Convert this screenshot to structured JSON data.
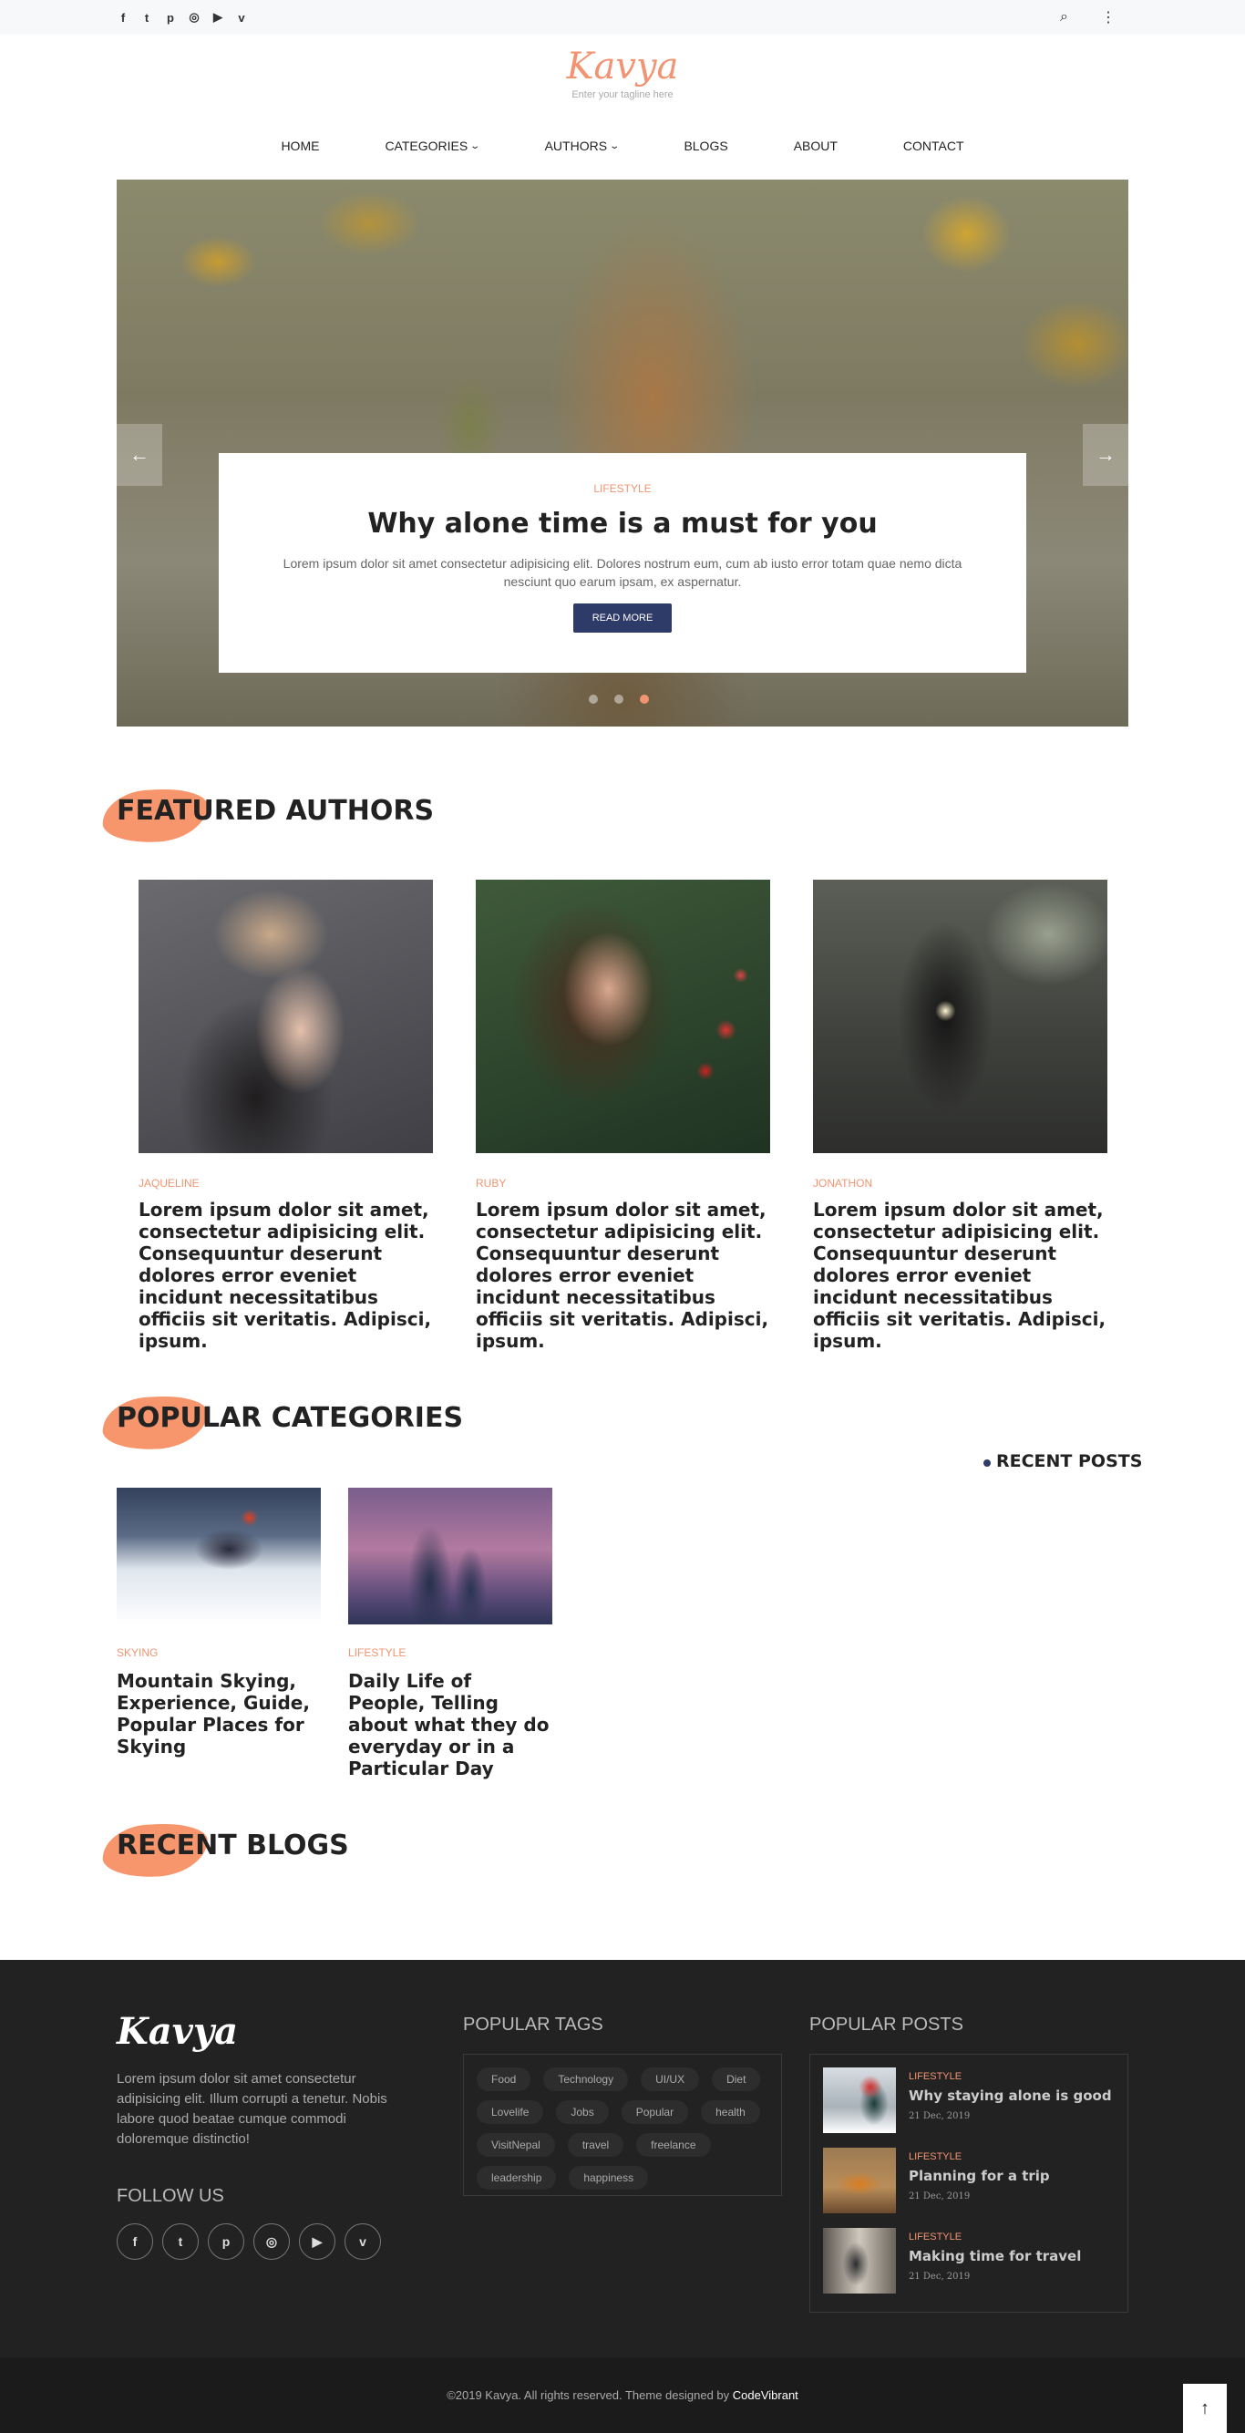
{
  "topbar": {
    "social": [
      "f",
      "t",
      "p",
      "◎",
      "▶",
      "v"
    ],
    "search_icon": "⌕",
    "menu_icon": "⋮"
  },
  "header": {
    "logo": "Kavya",
    "tagline": "Enter your tagline here"
  },
  "nav": [
    "HOME",
    "CATEGORIES",
    "AUTHORS",
    "BLOGS",
    "ABOUT",
    "CONTACT"
  ],
  "hero": {
    "category": "LIFESTYLE",
    "title": "Why alone time is a must for you",
    "text": "Lorem ipsum dolor sit amet consectetur adipisicing elit. Dolores nostrum eum, cum ab iusto error totam quae nemo dicta nesciunt quo earum ipsam, ex aspernatur.",
    "button": "READ MORE",
    "prev_arrow": "←",
    "next_arrow": "→",
    "active_slide": 3
  },
  "sections": {
    "featured_authors": "FEATURED AUTHORS",
    "popular_categories": "POPULAR CATEGORIES",
    "recent_posts": "RECENT POSTS",
    "recent_blogs": "RECENT BLOGS"
  },
  "authors": [
    {
      "name": "JAQUELINE",
      "text": "Lorem ipsum dolor sit amet, consectetur adipisicing elit. Consequuntur deserunt dolores error eveniet incidunt necessitatibus officiis sit veritatis. Adipisci, ipsum."
    },
    {
      "name": "RUBY",
      "text": "Lorem ipsum dolor sit amet, consectetur adipisicing elit. Consequuntur deserunt dolores error eveniet incidunt necessitatibus officiis sit veritatis. Adipisci, ipsum."
    },
    {
      "name": "JONATHON",
      "text": "Lorem ipsum dolor sit amet, consectetur adipisicing elit. Consequuntur deserunt dolores error eveniet incidunt necessitatibus officiis sit veritatis. Adipisci, ipsum."
    }
  ],
  "categories": [
    {
      "name": "SKYING",
      "title": "Mountain Skying, Experience, Guide, Popular Places for Skying"
    },
    {
      "name": "LIFESTYLE",
      "title": "Daily Life of People, Telling about what they do everyday or in a Particular Day"
    }
  ],
  "footer": {
    "logo": "Kavya",
    "about": "Lorem ipsum dolor sit amet consectetur adipisicing elit. Illum corrupti a tenetur. Nobis labore quod beatae cumque commodi doloremque distinctio!",
    "follow": "FOLLOW US",
    "social": [
      "f",
      "t",
      "p",
      "◎",
      "▶",
      "v"
    ],
    "tags_title": "POPULAR TAGS",
    "tags": [
      "Food",
      "Technology",
      "UI/UX",
      "Diet",
      "Lovelife",
      "Jobs",
      "Popular",
      "health",
      "VisitNepal",
      "travel",
      "freelance",
      "leadership",
      "happiness"
    ],
    "posts_title": "POPULAR POSTS",
    "posts": [
      {
        "category": "LIFESTYLE",
        "title": "Why staying alone is good",
        "date": "21 Dec, 2019"
      },
      {
        "category": "LIFESTYLE",
        "title": "Planning for a trip",
        "date": "21 Dec, 2019"
      },
      {
        "category": "LIFESTYLE",
        "title": "Making time for travel",
        "date": "21 Dec, 2019"
      }
    ]
  },
  "copyright": {
    "text": "©2019 Kavya. All rights reserved. Theme designed by ",
    "brand": "CodeVibrant"
  },
  "to_top": "↑",
  "colors": {
    "accent": "#f29471",
    "primary": "#2e3a67",
    "footer_bg": "#222222"
  }
}
